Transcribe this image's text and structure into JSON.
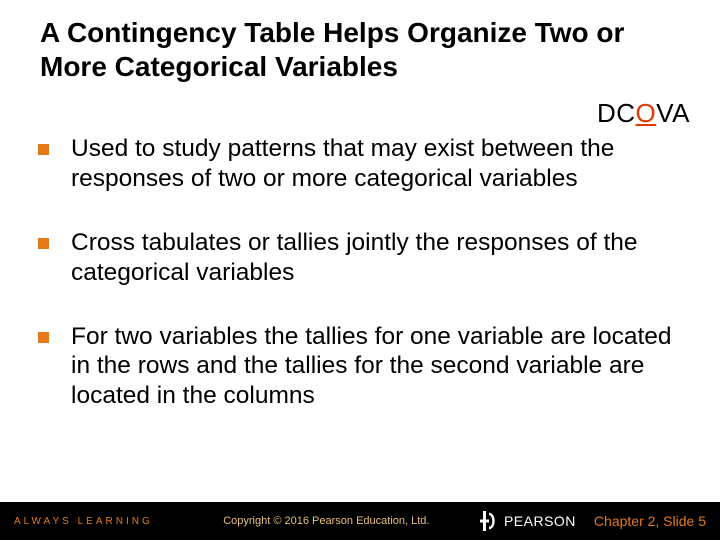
{
  "title": "A Contingency Table Helps Organize Two or More Categorical Variables",
  "dcova": {
    "pre": "DC",
    "accent": "O",
    "post": "VA"
  },
  "bullets": [
    "Used to study patterns that may exist between the responses of two or more categorical variables",
    "Cross tabulates or tallies jointly the responses of the categorical variables",
    "For two variables the tallies for one variable are located in the rows and the tallies for the second variable are located in the columns"
  ],
  "footer": {
    "always": "ALWAYS LEARNING",
    "copyright": "Copyright © 2016 Pearson Education, Ltd.",
    "brand": "PEARSON",
    "pagenum": "Chapter 2, Slide 5"
  },
  "colors": {
    "bullet": "#e57a1a",
    "accent_text": "#e03a00",
    "footer_bg": "#000000",
    "footer_brand": "#ffffff",
    "footer_always": "#e57a1a",
    "footer_copy": "#e5c07a",
    "footer_page": "#e57a1a"
  }
}
